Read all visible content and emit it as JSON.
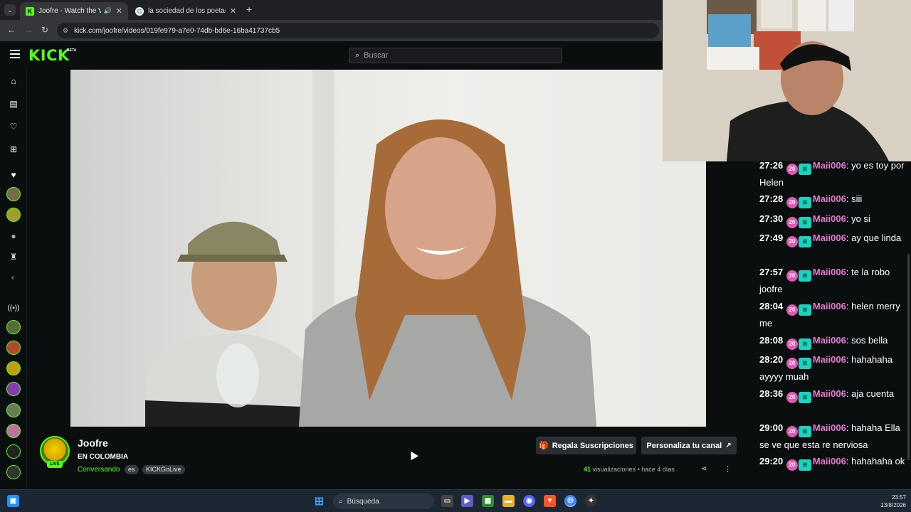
{
  "browser": {
    "tabs": [
      {
        "title": "Joofre - Watch the VOD on",
        "favicon": "K",
        "active": true
      },
      {
        "title": "la sociedad de los poetas muer",
        "favicon": "G",
        "active": false
      }
    ],
    "url": "kick.com/joofre/videos/019fe979-a7e0-74db-bd6e-16ba41737cb5"
  },
  "header": {
    "logo": "KICK",
    "beta": "BETA",
    "search_placeholder": "Buscar"
  },
  "chat": {
    "messages": [
      {
        "time": "27:26",
        "badge": "20",
        "user": "Maii006",
        "text": ": yo es toy por Helen"
      },
      {
        "time": "27:28",
        "badge": "20",
        "user": "Maii006",
        "text": ": siii"
      },
      {
        "time": "27:30",
        "badge": "20",
        "user": "Maii006",
        "text": ": yo si"
      },
      {
        "time": "27:49",
        "badge": "20",
        "user": "Maii006",
        "text": ": ay que linda"
      },
      {
        "time": "27:57",
        "badge": "20",
        "user": "Maii006",
        "text": ": te la robo joofre"
      },
      {
        "time": "28:04",
        "badge": "20",
        "user": "Maii006",
        "text": ": helen merry me"
      },
      {
        "time": "28:08",
        "badge": "20",
        "user": "Maii006",
        "text": ": sos bella"
      },
      {
        "time": "28:20",
        "badge": "20",
        "user": "Maii006",
        "text": ": hahahaha ayyyy muah"
      },
      {
        "time": "28:36",
        "badge": "20",
        "user": "Maii006",
        "text": ": aja cuenta"
      },
      {
        "time": "29:00",
        "badge": "20",
        "user": "Maii006",
        "text": ": hahaha Ella se ve que esta re nerviosa"
      },
      {
        "time": "29:20",
        "badge": "20",
        "user": "Maii006",
        "text": ": hahahaha ok"
      }
    ]
  },
  "channel": {
    "name": "Joofre",
    "live_label": "LIVE",
    "title": "EN COLOMBIA",
    "category": "Conversando",
    "tags": [
      "es",
      "KICKGoLive"
    ],
    "gift_button": "Regala Suscripciones",
    "customize_button": "Personaliza tu canal",
    "views_count": "41",
    "views_label": "visualizaciones",
    "age": "hace 4 días"
  },
  "taskbar": {
    "search_label": "Búsqueda",
    "time": "23:57",
    "date": "13/8/2026"
  },
  "colors": {
    "kick_green": "#53fc18",
    "chat_username": "#e67ad0",
    "sub_badge": "#e058b0"
  }
}
